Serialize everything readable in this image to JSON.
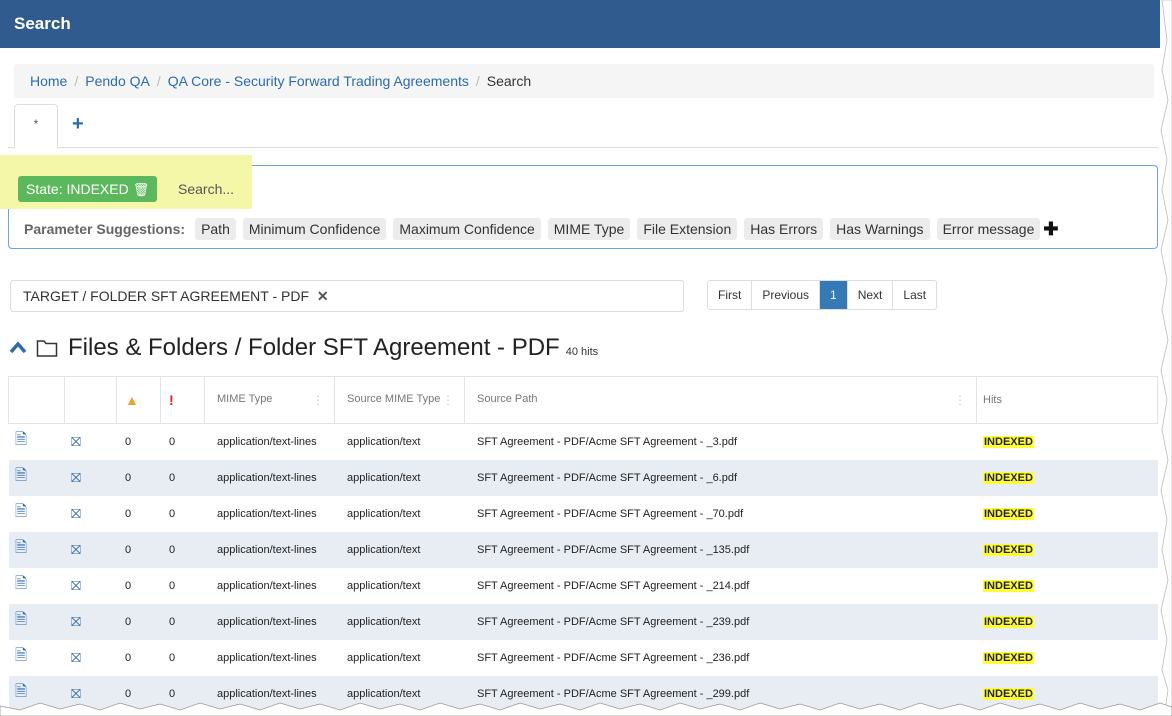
{
  "header": {
    "title": "Search"
  },
  "breadcrumb": {
    "items": [
      "Home",
      "Pendo QA",
      "QA Core - Security Forward Trading Agreements"
    ],
    "current": "Search",
    "separator": "/"
  },
  "tabs": {
    "active_label": "*",
    "add_label": "+"
  },
  "search": {
    "state_label": "State: INDEXED",
    "placeholder": "Search...",
    "suggestions_label": "Parameter Suggestions:",
    "suggestions": [
      "Path",
      "Minimum Confidence",
      "Maximum Confidence",
      "MIME Type",
      "File Extension",
      "Has Errors",
      "Has Warnings",
      "Error message"
    ]
  },
  "filter": {
    "label": "TARGET / FOLDER SFT AGREEMENT - PDF",
    "remove": "✕"
  },
  "pager": {
    "first": "First",
    "previous": "Previous",
    "current": "1",
    "next": "Next",
    "last": "Last"
  },
  "section": {
    "title": "Files & Folders / Folder SFT Agreement - PDF",
    "hits": "40 hits"
  },
  "table": {
    "headers": {
      "warn": "▲",
      "err": "!",
      "mime": "MIME Type",
      "source_mime": "Source MIME Type",
      "source_path": "Source Path",
      "hits": "Hits"
    },
    "rows": [
      {
        "warn": "0",
        "err": "0",
        "mime": "application/text-lines",
        "source_mime": "application/text",
        "path": "SFT Agreement - PDF/Acme SFT Agreement - _3.pdf",
        "status": "INDEXED"
      },
      {
        "warn": "0",
        "err": "0",
        "mime": "application/text-lines",
        "source_mime": "application/text",
        "path": "SFT Agreement - PDF/Acme SFT Agreement - _6.pdf",
        "status": "INDEXED"
      },
      {
        "warn": "0",
        "err": "0",
        "mime": "application/text-lines",
        "source_mime": "application/text",
        "path": "SFT Agreement - PDF/Acme SFT Agreement - _70.pdf",
        "status": "INDEXED"
      },
      {
        "warn": "0",
        "err": "0",
        "mime": "application/text-lines",
        "source_mime": "application/text",
        "path": "SFT Agreement - PDF/Acme SFT Agreement - _135.pdf",
        "status": "INDEXED"
      },
      {
        "warn": "0",
        "err": "0",
        "mime": "application/text-lines",
        "source_mime": "application/text",
        "path": "SFT Agreement - PDF/Acme SFT Agreement - _214.pdf",
        "status": "INDEXED"
      },
      {
        "warn": "0",
        "err": "0",
        "mime": "application/text-lines",
        "source_mime": "application/text",
        "path": "SFT Agreement - PDF/Acme SFT Agreement - _239.pdf",
        "status": "INDEXED"
      },
      {
        "warn": "0",
        "err": "0",
        "mime": "application/text-lines",
        "source_mime": "application/text",
        "path": "SFT Agreement - PDF/Acme SFT Agreement - _236.pdf",
        "status": "INDEXED"
      },
      {
        "warn": "0",
        "err": "0",
        "mime": "application/text-lines",
        "source_mime": "application/text",
        "path": "SFT Agreement - PDF/Acme SFT Agreement - _299.pdf",
        "status": "INDEXED"
      }
    ]
  },
  "colors": {
    "header_bg": "#2f5b8e",
    "state_badge": "#5cb85c",
    "highlight": "#f4f6a8",
    "indexed_highlight": "#ffff33",
    "link": "#2a6bb3"
  },
  "icons": [
    "trash-icon",
    "plus-icon",
    "close-icon",
    "chevron-up-icon",
    "folder-icon",
    "warning-icon",
    "error-icon",
    "document-icon",
    "hierarchy-icon"
  ]
}
